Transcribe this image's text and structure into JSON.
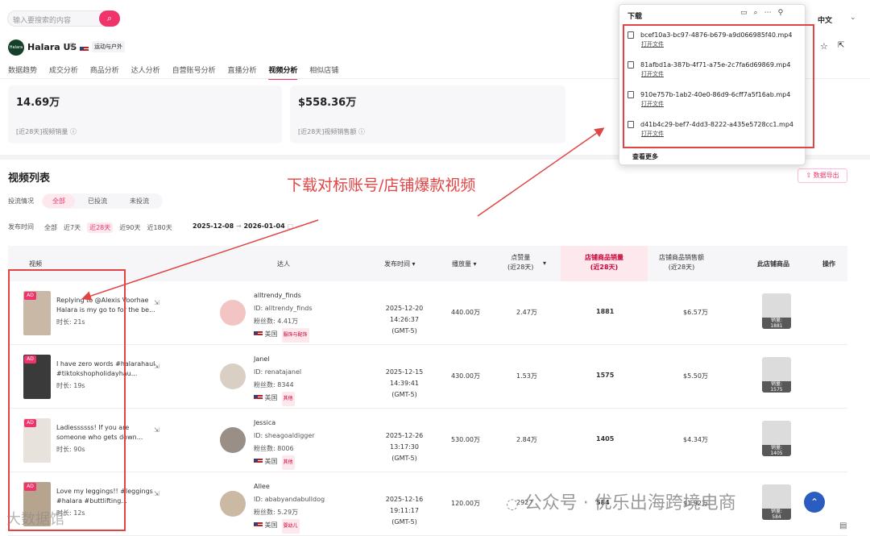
{
  "search": {
    "placeholder": "输入要搜索的内容"
  },
  "lang": "中文",
  "shop": {
    "name": "Halara US",
    "category": "运动与户外",
    "logo_text": "Halara"
  },
  "tabs": [
    "数据趋势",
    "成交分析",
    "商品分析",
    "达人分析",
    "自营账号分析",
    "直播分析",
    "视频分析",
    "相似店铺"
  ],
  "active_tab": "视频分析",
  "stats": [
    {
      "value": "14.69万",
      "label": "[近28天]视频销量"
    },
    {
      "value": "$558.36万",
      "label": "[近28天]视频销售额"
    }
  ],
  "list_title": "视频列表",
  "export_label": "数据导出",
  "filters": {
    "invest_label": "投流情况",
    "invest_options": [
      "全部",
      "已投流",
      "未投流"
    ],
    "time_label": "发布时间",
    "time_options": [
      "全部",
      "近7天",
      "近28天",
      "近90天",
      "近180天"
    ],
    "date_from": "2025-12-08",
    "date_to": "2026-01-04"
  },
  "columns": {
    "video": "视频",
    "creator": "达人",
    "pub_time": "发布时间",
    "plays": "播放量",
    "likes": "点赞量\n(近28天)",
    "shop_sales": "店铺商品销量\n(近28天)",
    "shop_revenue": "店铺商品销售额\n(近28天)",
    "products": "此店铺商品",
    "actions": "操作"
  },
  "rows": [
    {
      "title1": "Replying to @Alexis Voorhae",
      "title2": "Halara is my go to for the be...",
      "duration": "时长:   21s",
      "handle": "alltrendy_finds",
      "id": "ID:   alltrendy_finds",
      "fans": "粉丝数:  4.41万",
      "country": "美国",
      "tag": "服饰与配饰",
      "time1": "2025-12-20 14:26:37",
      "time2": "(GMT-5)",
      "plays": "440.00万",
      "likes": "2.47万",
      "sales": "1881",
      "revenue": "$6.57万",
      "prod_label": "销量:",
      "prod_val": "1881"
    },
    {
      "title1": "I have zero words #halarahaul",
      "title2": "#tiktokshopholidayhau...",
      "duration": "时长:   19s",
      "handle": "Janel",
      "id": "ID:   renatajanel",
      "fans": "粉丝数:  8344",
      "country": "美国",
      "tag": "其他",
      "time1": "2025-12-15 14:39:41",
      "time2": "(GMT-5)",
      "plays": "430.00万",
      "likes": "1.53万",
      "sales": "1575",
      "revenue": "$5.50万",
      "prod_label": "销量:",
      "prod_val": "1575"
    },
    {
      "title1": "Ladiessssss! If you are",
      "title2": "someone who gets down...",
      "duration": "时长:   90s",
      "handle": "Jessica",
      "id": "ID:   sheagoaldigger",
      "fans": "粉丝数:  8006",
      "country": "美国",
      "tag": "其他",
      "time1": "2025-12-26 13:17:30",
      "time2": "(GMT-5)",
      "plays": "530.00万",
      "likes": "2.84万",
      "sales": "1405",
      "revenue": "$4.34万",
      "prod_label": "销量:",
      "prod_val": "1405"
    },
    {
      "title1": "Love my leggings!! #leggings",
      "title2": "#halara #buttlifting...",
      "duration": "时长:   12s",
      "handle": "Allee",
      "id": "ID:   ababyandabulldog",
      "fans": "粉丝数:  5.29万",
      "country": "美国",
      "tag": "婴幼儿",
      "time1": "2025-12-16 19:11:17",
      "time2": "(GMT-5)",
      "plays": "120.00万",
      "likes": "2927",
      "sales": "584",
      "revenue": "$1.92万",
      "prod_label": "销量:",
      "prod_val": "584"
    }
  ],
  "downloads": {
    "title": "下载",
    "open": "打开文件",
    "more": "查看更多",
    "files": [
      "bcef10a3-bc97-4876-b679-a9d066985f40.mp4",
      "81afbd1a-387b-4f71-a75e-2c7fa6d69869.mp4",
      "910e757b-1ab2-40e0-86d9-6cff7a5f16ab.mp4",
      "d41b4c29-bef7-4dd3-8222-a435e5728cc1.mp4"
    ]
  },
  "annotation": "下载对标账号/店铺爆款视频",
  "watermark": "公众号 · 优乐出海跨境电商",
  "watermark2": "大数据馆"
}
